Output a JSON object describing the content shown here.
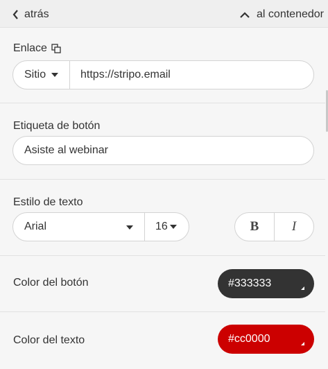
{
  "nav": {
    "back_label": "atrás",
    "container_label": "al contenedor"
  },
  "link": {
    "title": "Enlace",
    "type_value": "Sitio",
    "url_value": "https://stripo.email"
  },
  "button_label": {
    "title": "Etiqueta de botón",
    "value": "Asiste al webinar"
  },
  "text_style": {
    "title": "Estilo de texto",
    "font_family": "Arial",
    "font_size": "16",
    "bold_label": "B",
    "italic_label": "I"
  },
  "button_color": {
    "label": "Color del botón",
    "value": "#333333",
    "hex": "#333333"
  },
  "text_color": {
    "label": "Color del texto",
    "value": "#cc0000",
    "hex": "#cc0000"
  },
  "icons": {
    "back": "chevron-left-icon",
    "container": "chevron-up-icon",
    "link_info": "copy-square-icon",
    "dropdown": "caret-down-icon"
  }
}
